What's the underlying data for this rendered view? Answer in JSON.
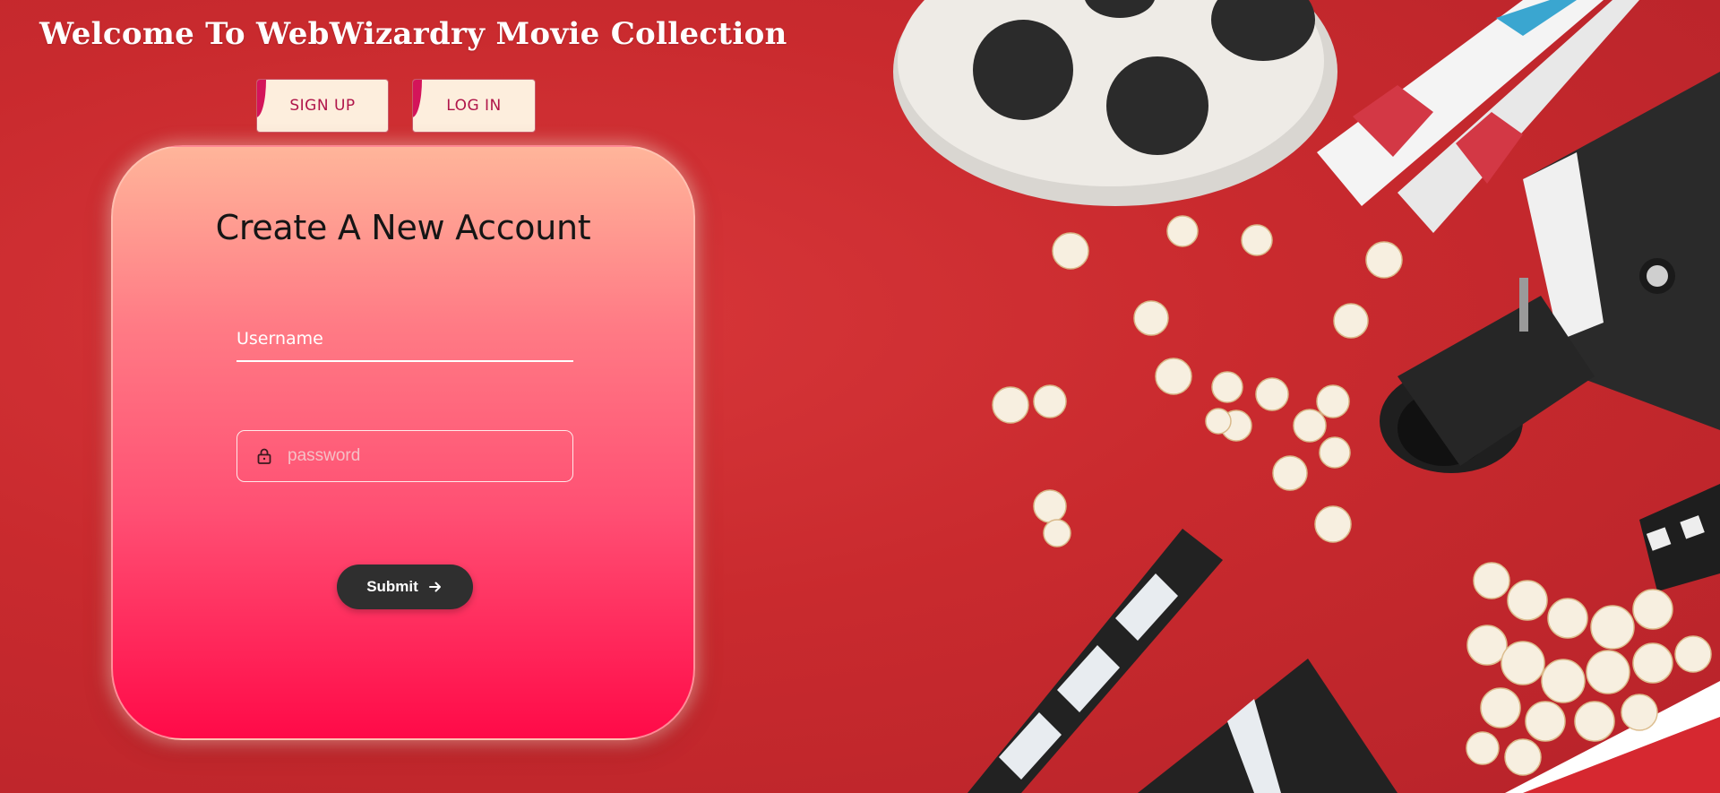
{
  "header": {
    "title": "Welcome To WebWizardry Movie Collection"
  },
  "nav": {
    "signup_label": "SIGN UP",
    "login_label": "LOG IN"
  },
  "form": {
    "title": "Create A New Account",
    "username_placeholder": "Username",
    "password_placeholder": "password",
    "submit_label": "Submit",
    "submit_icon": "arrow-right-icon",
    "password_icon": "lock-icon"
  },
  "decor": {
    "items": [
      "film-reel",
      "3d-glasses",
      "movie-camera",
      "popcorn",
      "clapperboard"
    ]
  },
  "colors": {
    "background": "#c92a2e",
    "card_top": "#ffb59a",
    "card_bottom": "#ff0a48",
    "button_bg": "#fdeedd",
    "button_text": "#b0154a",
    "submit_bg": "#2f2f2f"
  }
}
